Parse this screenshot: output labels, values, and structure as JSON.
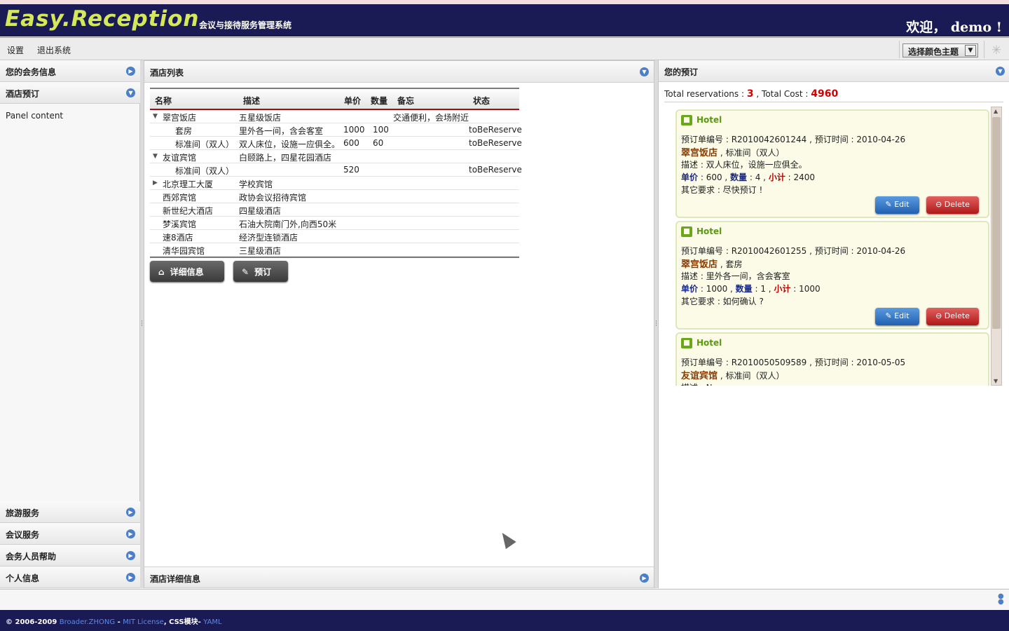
{
  "app": {
    "logo": "Easy.Reception",
    "subtitle": "会议与接待服务管理系统",
    "welcome": "欢迎， demo !"
  },
  "menu": {
    "settings": "设置",
    "logout": "退出系统",
    "theme": "选择颜色主题"
  },
  "west": {
    "panels": [
      "您的会务信息",
      "酒店预订"
    ],
    "content": "Panel content",
    "bottom_panels": [
      "旅游服务",
      "会议服务",
      "会务人员帮助",
      "个人信息"
    ]
  },
  "center": {
    "title": "酒店列表",
    "columns": [
      "名称",
      "描述",
      "单价",
      "数量",
      "备忘",
      "状态"
    ],
    "rows": [
      {
        "tree": "▼",
        "name": "翠宫饭店",
        "desc": "五星级饭店",
        "price": "",
        "qty": "",
        "memo": "交通便利，会场附近",
        "status": ""
      },
      {
        "tree": "",
        "name": "套房",
        "desc": "里外各一间，含会客室",
        "price": "1000",
        "qty": "100",
        "memo": "",
        "status": "toBeReserve"
      },
      {
        "tree": "",
        "name": "标准间（双人）",
        "desc": "双人床位，设施一应俱全。",
        "price": "600",
        "qty": "60",
        "memo": "",
        "status": "toBeReserve"
      },
      {
        "tree": "▼",
        "name": "友谊宾馆",
        "desc": "白颐路上，四星花园酒店",
        "price": "",
        "qty": "",
        "memo": "",
        "status": ""
      },
      {
        "tree": "",
        "name": "标准间（双人）",
        "desc": "",
        "price": "520",
        "qty": "",
        "memo": "",
        "status": "toBeReserve"
      },
      {
        "tree": "▶",
        "name": "北京理工大厦",
        "desc": "学校宾馆",
        "price": "",
        "qty": "",
        "memo": "",
        "status": ""
      },
      {
        "tree": "",
        "name": "西郊宾馆",
        "desc": "政协会议招待宾馆",
        "price": "",
        "qty": "",
        "memo": "",
        "status": ""
      },
      {
        "tree": "",
        "name": "新世纪大酒店",
        "desc": "四星级酒店",
        "price": "",
        "qty": "",
        "memo": "",
        "status": ""
      },
      {
        "tree": "",
        "name": "梦溪宾馆",
        "desc": "石油大院南门外,向西50米",
        "price": "",
        "qty": "",
        "memo": "",
        "status": ""
      },
      {
        "tree": "",
        "name": "速8酒店",
        "desc": "经济型连锁酒店",
        "price": "",
        "qty": "",
        "memo": "",
        "status": ""
      },
      {
        "tree": "",
        "name": "清华园宾馆",
        "desc": "三星级酒店",
        "price": "",
        "qty": "",
        "memo": "",
        "status": ""
      }
    ],
    "buttons": {
      "detail": "详细信息",
      "reserve": "预订"
    },
    "bottom_title": "酒店详细信息"
  },
  "east": {
    "title": "您的预订",
    "total_label": "Total reservations :",
    "total_count": "3",
    "cost_label": ", Total Cost :",
    "total_cost": "4960",
    "cards": [
      {
        "type": "Hotel",
        "order_label": "预订单编号 : ",
        "order": "R2010042601244",
        "time_label": " , 预订时间 : ",
        "time": "2010-04-26",
        "hotel": "翠宫饭店",
        "room": " , 标准间（双人）",
        "desc": "描述 : 双人床位，设施一应俱全。",
        "price_label": "单价",
        "price": " : 600 , ",
        "qty_label": "数量",
        "qty": " : 4 , ",
        "sub_label": "小计",
        "sub": " : 2400",
        "other": "其它要求 : 尽快预订 !",
        "edit": "Edit",
        "delete": "Delete"
      },
      {
        "type": "Hotel",
        "order_label": "预订单编号 : ",
        "order": "R2010042601255",
        "time_label": " , 预订时间 : ",
        "time": "2010-04-26",
        "hotel": "翠宫饭店",
        "room": " , 套房",
        "desc": "描述 : 里外各一间，含会客室",
        "price_label": "单价",
        "price": " : 1000 , ",
        "qty_label": "数量",
        "qty": " : 1 , ",
        "sub_label": "小计",
        "sub": " : 1000",
        "other": "其它要求 : 如何确认 ?",
        "edit": "Edit",
        "delete": "Delete"
      },
      {
        "type": "Hotel",
        "order_label": "预订单编号 : ",
        "order": "R2010050509589",
        "time_label": " , 预订时间 : ",
        "time": "2010-05-05",
        "hotel": "友谊宾馆",
        "room": " , 标准间（双人）",
        "desc": "描述 : None"
      }
    ]
  },
  "footer": {
    "copyright": "© 2006-2009 ",
    "author": "Broader.ZHONG",
    "sep1": " - ",
    "license": "MIT License",
    "css": ", CSS模块- ",
    "yaml": "YAML"
  }
}
